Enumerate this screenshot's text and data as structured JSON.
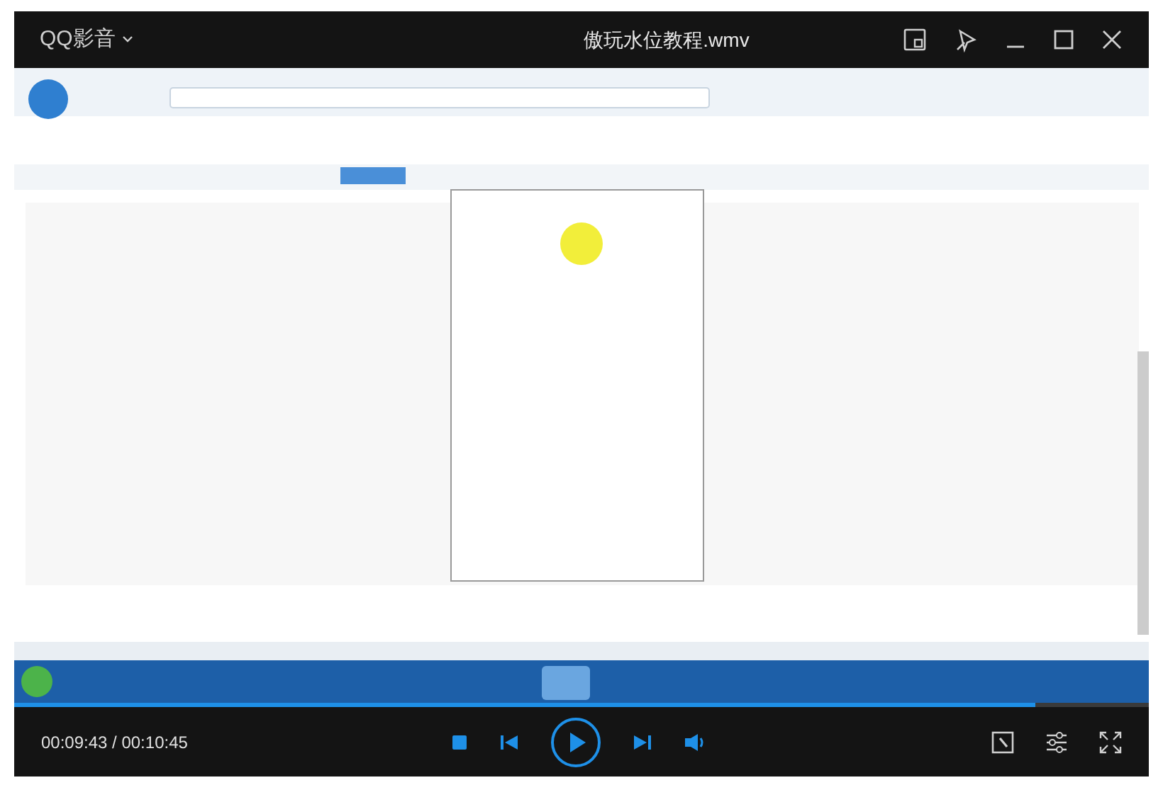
{
  "window": {
    "app_menu": "QQ影音",
    "title": "傲玩水位教程.wmv"
  },
  "progress": {
    "level": 0.9
  },
  "controls": {
    "time": "00:09:43 / 00:10:45"
  }
}
